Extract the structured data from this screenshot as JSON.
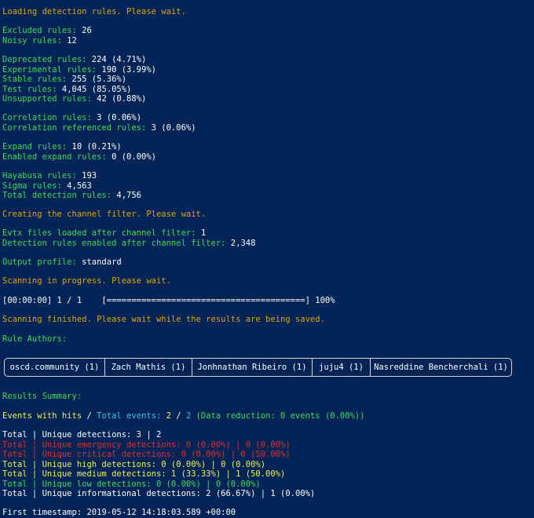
{
  "loading": "Loading detection rules. Please wait.",
  "excluded": {
    "label": "Excluded rules:",
    "value": " 26"
  },
  "noisy": {
    "label": "Noisy rules:",
    "value": " 12"
  },
  "deprecated": {
    "label": "Deprecated rules:",
    "value": " 224 (4.71%)"
  },
  "experimental": {
    "label": "Experimental rules:",
    "value": " 190 (3.99%)"
  },
  "stable": {
    "label": "Stable rules:",
    "value": " 255 (5.36%)"
  },
  "test": {
    "label": "Test rules:",
    "value": " 4,045 (85.05%)"
  },
  "unsupported": {
    "label": "Unsupported rules:",
    "value": " 42 (0.88%)"
  },
  "correlation": {
    "label": "Correlation rules:",
    "value": " 3 (0.06%)"
  },
  "correlation_ref": {
    "label": "Correlation referenced rules:",
    "value": " 3 (0.06%)"
  },
  "expand": {
    "label": "Expand rules:",
    "value": " 10 (0.21%)"
  },
  "enabled_expand": {
    "label": "Enabled expand rules:",
    "value": " 0 (0.00%)"
  },
  "hayabusa": {
    "label": "Hayabusa rules:",
    "value": " 193"
  },
  "sigma": {
    "label": "Sigma rules:",
    "value": " 4,563"
  },
  "total_detection": {
    "label": "Total detection rules:",
    "value": " 4,756"
  },
  "channel_filter": "Creating the channel filter. Please wait.",
  "evtx_loaded": {
    "label": "Evtx files loaded after channel filter:",
    "value": " 1"
  },
  "rules_enabled": {
    "label": "Detection rules enabled after channel filter:",
    "value": " 2,348"
  },
  "output_profile": {
    "label": "Output profile:",
    "value": " standard"
  },
  "scanning": "Scanning in progress. Please wait.",
  "progress": {
    "text": "[00:00:00] 1 / 1    [========================================] 100%",
    "percent": 100
  },
  "scan_finished": "Scanning finished. Please wait while the results are being saved.",
  "rule_authors_label": "Rule Authors:",
  "authors": [
    "oscd.community (1)",
    "Zach Mathis (1)",
    "Jonhnathan Ribeiro (1)",
    "juju4 (1)",
    "Nasreddine Bencherchali (1)"
  ],
  "results_summary": "Results Summary:",
  "events": {
    "hits_label": "Events with hits",
    "slash1": " / ",
    "total_label": "Total events:",
    "hits_value": " 2",
    "slash2": " / ",
    "total_value": "2",
    "reduction": " (Data reduction: 0 events (0.00%))"
  },
  "summary_lines": [
    {
      "text": "Total | Unique detections: 3 | 2",
      "color": "#ffffff"
    },
    {
      "text": "Total | Unique emergency detections: 0 (0.00%) | 0 (0.00%)",
      "color": "#e0312a"
    },
    {
      "text": "Total | Unique critical detections: 0 (0.00%) | 0 (50.00%)",
      "color": "#e0312a"
    },
    {
      "text": "Total | Unique high detections: 0 (0.00%) | 0 (0.00%)",
      "color": "#f2f255"
    },
    {
      "text": "Total | Unique medium detections: 1 (33.33%) | 1 (50.00%)",
      "color": "#f2f255"
    },
    {
      "text": "Total | Unique low detections: 0 (0.00%) | 0 (0.00%)",
      "color": "#3fd957"
    },
    {
      "text": "Total | Unique informational detections: 2 (66.67%) | 1 (0.00%)",
      "color": "#ffffff"
    }
  ],
  "first_timestamp": {
    "label": "First timestamp:",
    "value": " 2019-05-12 14:18:03.589 +00:00"
  }
}
